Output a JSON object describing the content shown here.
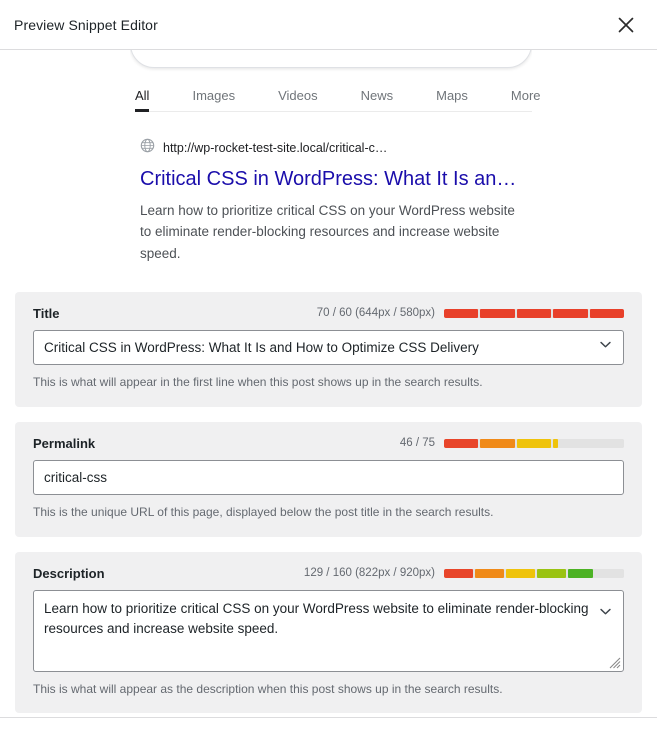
{
  "modal": {
    "title": "Preview Snippet Editor",
    "close_icon": "close-icon"
  },
  "serp_preview": {
    "search_icon": "search-icon",
    "tabs": [
      {
        "label": "All",
        "active": true
      },
      {
        "label": "Images",
        "active": false
      },
      {
        "label": "Videos",
        "active": false
      },
      {
        "label": "News",
        "active": false
      },
      {
        "label": "Maps",
        "active": false
      },
      {
        "label": "More",
        "active": false
      }
    ],
    "result": {
      "favicon_icon": "globe-icon",
      "url": "http://wp-rocket-test-site.local/critical-c…",
      "title": "Critical CSS in WordPress: What It Is an…",
      "description": "Learn how to prioritize critical CSS on your WordPress website to eliminate render-blocking resources and increase website speed."
    }
  },
  "fields": {
    "title": {
      "label": "Title",
      "counter": "70 / 60 (644px / 580px)",
      "value": "Critical CSS in WordPress: What It Is and How to Optimize CSS Delivery",
      "hint": "This is what will appear in the first line when this post shows up in the search results.",
      "chevron_icon": "chevron-down-icon",
      "meter": {
        "total_segments": 5,
        "segments": [
          {
            "width_pct": 20,
            "color": "#e8402a"
          },
          {
            "width_pct": 20,
            "color": "#e8402a"
          },
          {
            "width_pct": 20,
            "color": "#e8402a"
          },
          {
            "width_pct": 20,
            "color": "#e8402a"
          },
          {
            "width_pct": 20,
            "color": "#e8402a"
          }
        ]
      }
    },
    "permalink": {
      "label": "Permalink",
      "counter": "46 / 75",
      "value": "critical-css",
      "hint": "This is the unique URL of this page, displayed below the post title in the search results.",
      "meter": {
        "total_segments": 5,
        "segments": [
          {
            "width_pct": 20,
            "color": "#e8452a"
          },
          {
            "width_pct": 20,
            "color": "#f08a18"
          },
          {
            "width_pct": 20,
            "color": "#efc30b"
          },
          {
            "width_pct": 3,
            "color": "#efc30b"
          },
          {
            "width_pct": 37,
            "color": "#e2e2e2"
          }
        ]
      }
    },
    "description": {
      "label": "Description",
      "counter": "129 / 160 (822px / 920px)",
      "value": "Learn how to prioritize critical CSS on your WordPress website to eliminate render-blocking resources and increase website speed.",
      "hint": "This is what will appear as the description when this post shows up in the search results.",
      "chevron_icon": "chevron-down-icon",
      "resize_icon": "resize-grip-icon",
      "meter": {
        "total_segments": 6,
        "segments": [
          {
            "width_pct": 17,
            "color": "#e8452a"
          },
          {
            "width_pct": 17,
            "color": "#f08a18"
          },
          {
            "width_pct": 17,
            "color": "#efc30b"
          },
          {
            "width_pct": 17,
            "color": "#9ac312"
          },
          {
            "width_pct": 15,
            "color": "#4cb224"
          },
          {
            "width_pct": 17,
            "color": "#e2e2e2"
          }
        ]
      }
    }
  },
  "colors": {
    "section_bg": "#f0f0f1",
    "link_blue": "#1a0dab",
    "border": "#8c8f94",
    "muted_text": "#646970"
  }
}
